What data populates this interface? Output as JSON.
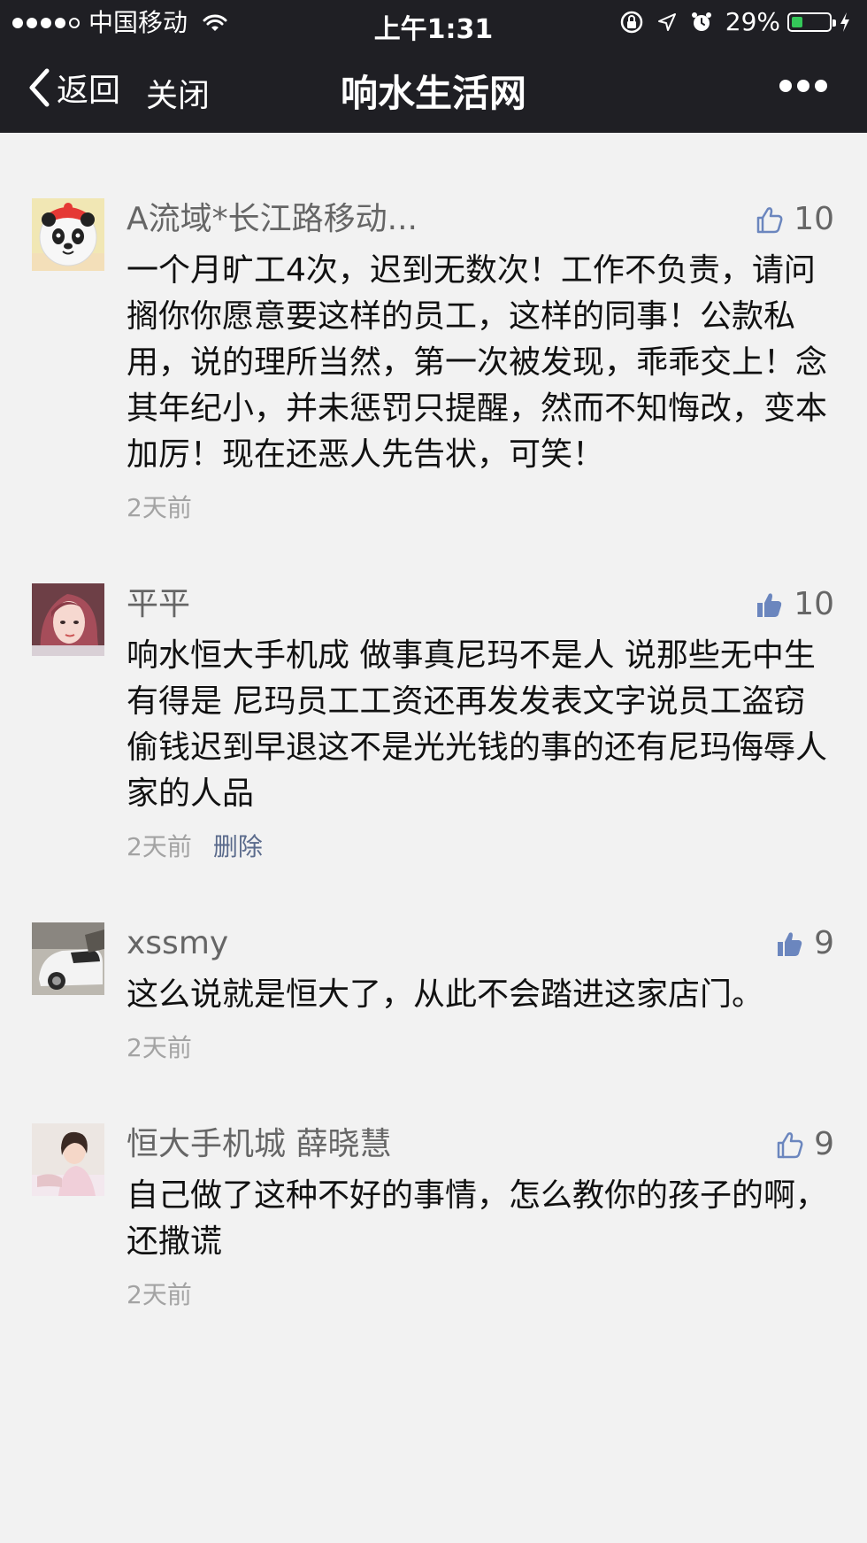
{
  "status_bar": {
    "carrier": "中国移动",
    "time": "上午1:31",
    "battery_percent_text": "29%",
    "battery_fraction": 0.29,
    "icons": [
      "signal-dots-icon",
      "wifi-icon",
      "rotation-lock-icon",
      "location-icon",
      "alarm-icon",
      "battery-icon",
      "charging-icon"
    ]
  },
  "nav": {
    "back_label": "返回",
    "close_label": "关闭",
    "title": "响水生活网",
    "more_icon": "more-icon"
  },
  "colors": {
    "nav_bg": "#1f1f24",
    "page_bg": "#f2f2f2",
    "thumb_blue": "#6b86be",
    "delete_blue": "#5b6b8c",
    "battery_green": "#34c759"
  },
  "comments": [
    {
      "author": "A流域*长江路移动...",
      "likes": "10",
      "text": "一个月旷工4次，迟到无数次！工作不负责，请问搁你你愿意要这样的员工，这样的同事！公款私用，说的理所当然，第一次被发现，乖乖交上！念其年纪小，并未惩罚只提醒，然而不知悔改，变本加厉！现在还恶人先告状，可笑！",
      "time": "2天前",
      "delete_label": "",
      "thumb_filled": false
    },
    {
      "author": "平平",
      "likes": "10",
      "text": "响水恒大手机成 做事真尼玛不是人 说那些无中生有得是 尼玛员工工资还再发发表文字说员工盗窃偷钱迟到早退这不是光光钱的事的还有尼玛侮辱人家的人品",
      "time": "2天前",
      "delete_label": "删除",
      "thumb_filled": true
    },
    {
      "author": "xssmy",
      "likes": "9",
      "text": "这么说就是恒大了，从此不会踏进这家店门。",
      "time": "2天前",
      "delete_label": "",
      "thumb_filled": true
    },
    {
      "author": "恒大手机城 薛晓慧",
      "likes": "9",
      "text": "自己做了这种不好的事情，怎么教你的孩子的啊，还撒谎",
      "time": "2天前",
      "delete_label": "",
      "thumb_filled": false
    }
  ]
}
